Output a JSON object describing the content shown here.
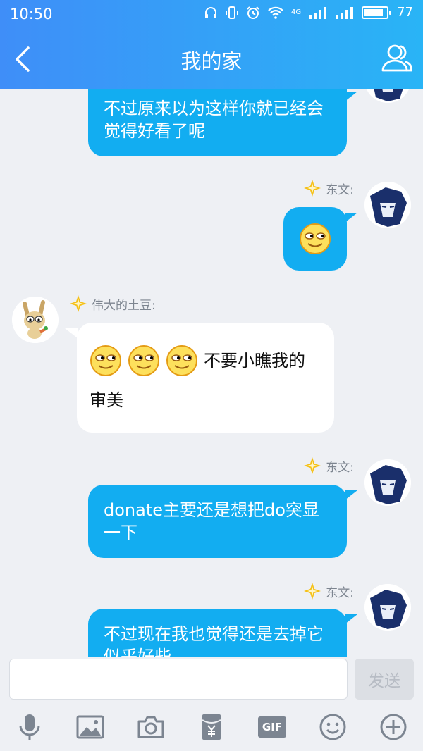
{
  "status_bar": {
    "time": "10:50",
    "network_label": "4G",
    "battery": "77"
  },
  "header": {
    "title": "我的家"
  },
  "messages": {
    "m1": {
      "text": "不过原来以为这样你就已经会觉得好看了呢"
    },
    "m2": {
      "sender": "东文:"
    },
    "m3": {
      "sender": "伟大的土豆:",
      "text_inline": "不要小瞧我的",
      "text_wrap": "审美"
    },
    "m4": {
      "sender": "东文:",
      "text": "donate主要还是想把do突显一下"
    },
    "m5": {
      "sender": "东文:",
      "text": "不过现在我也觉得还是去掉它似乎好些"
    }
  },
  "input": {
    "placeholder": "",
    "send_label": "发送"
  },
  "toolbar": {
    "gif_label": "GIF"
  },
  "colors": {
    "accent": "#12adf1",
    "header_start": "#3f8ef8",
    "header_end": "#29b4f6"
  }
}
